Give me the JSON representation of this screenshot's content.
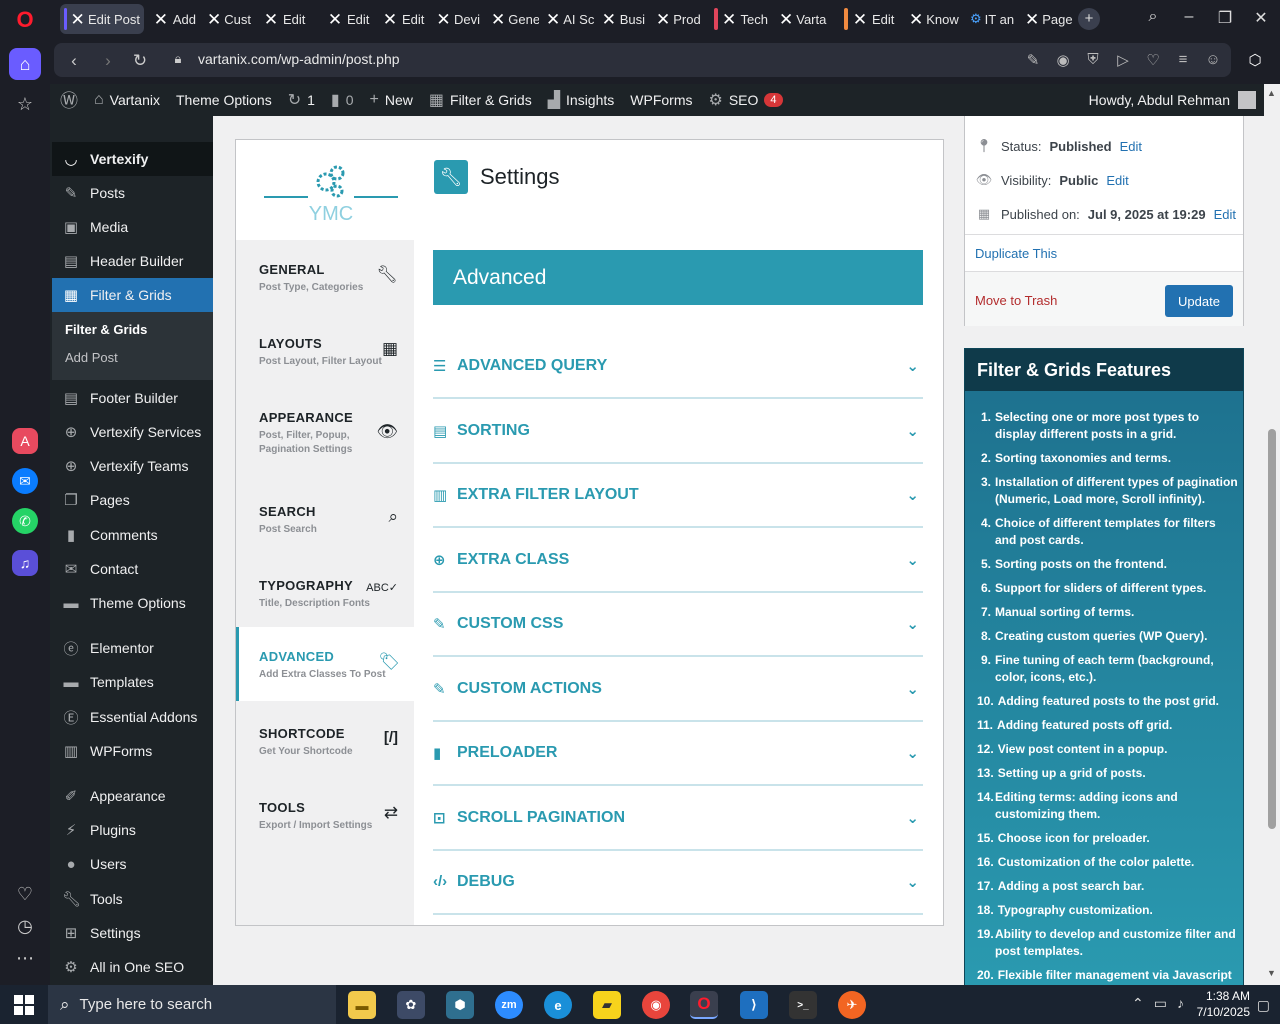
{
  "browser": {
    "tabs": [
      "Edit Post",
      "Add",
      "Cust",
      "Edit",
      "Edit",
      "Edit",
      "Devi",
      "Gene",
      "AI Sc",
      "Busi",
      "Prod",
      "Tech",
      "Varta",
      "Edit",
      "Know",
      "IT an",
      "Page"
    ],
    "url": "vartanix.com/wp-admin/post.php"
  },
  "adminbar": {
    "site": "Vartanix",
    "theme_options": "Theme Options",
    "updates": "1",
    "comments": "0",
    "new": "New",
    "filter_grids": "Filter & Grids",
    "insights": "Insights",
    "wpforms": "WPForms",
    "seo": "SEO",
    "seo_count": "4",
    "howdy": "Howdy, Abdul Rehman"
  },
  "menu": {
    "vertexify": "Vertexify",
    "posts": "Posts",
    "media": "Media",
    "header_builder": "Header Builder",
    "filter_grids": "Filter & Grids",
    "sub_filter_grids": "Filter & Grids",
    "sub_add_post": "Add Post",
    "footer_builder": "Footer Builder",
    "vertexify_services": "Vertexify Services",
    "vertexify_teams": "Vertexify Teams",
    "pages": "Pages",
    "comments": "Comments",
    "contact": "Contact",
    "theme_options": "Theme Options",
    "elementor": "Elementor",
    "templates": "Templates",
    "essential_addons": "Essential Addons",
    "wpforms": "WPForms",
    "appearance": "Appearance",
    "plugins": "Plugins",
    "users": "Users",
    "tools": "Tools",
    "settings": "Settings",
    "aioseo": "All in One SEO"
  },
  "plugin": {
    "logo_text": "YMC",
    "settings_title": "Settings",
    "tabs": [
      {
        "title": "GENERAL",
        "sub": "Post Type, Categories"
      },
      {
        "title": "LAYOUTS",
        "sub": "Post Layout, Filter Layout"
      },
      {
        "title": "APPEARANCE",
        "sub": "Post, Filter, Popup, Pagination Settings"
      },
      {
        "title": "SEARCH",
        "sub": "Post Search"
      },
      {
        "title": "TYPOGRAPHY",
        "sub": "Title, Description Fonts"
      },
      {
        "title": "ADVANCED",
        "sub": "Add Extra Classes To Post"
      },
      {
        "title": "SHORTCODE",
        "sub": "Get Your Shortcode"
      },
      {
        "title": "TOOLS",
        "sub": "Export / Import Settings"
      }
    ],
    "banner": "Advanced",
    "sections": [
      "ADVANCED QUERY",
      "SORTING",
      "EXTRA FILTER LAYOUT",
      "EXTRA CLASS",
      "CUSTOM CSS",
      "CUSTOM ACTIONS",
      "PRELOADER",
      "SCROLL PAGINATION",
      "DEBUG"
    ]
  },
  "publish": {
    "status_label": "Status:",
    "status_value": "Published",
    "visibility_label": "Visibility:",
    "visibility_value": "Public",
    "published_label": "Published on:",
    "published_value": "Jul 9, 2025 at 19:29",
    "edit": "Edit",
    "duplicate": "Duplicate This",
    "trash": "Move to Trash",
    "update": "Update"
  },
  "features": {
    "title": "Filter & Grids Features",
    "items": [
      "Selecting one or more post types to display different posts in a grid.",
      "Sorting taxonomies and terms.",
      "Installation of different types of pagination (Numeric, Load more, Scroll infinity).",
      "Choice of different templates for filters and post cards.",
      "Sorting posts on the frontend.",
      "Support for sliders of different types.",
      "Manual sorting of terms.",
      "Creating custom queries (WP Query).",
      "Fine tuning of each term (background, color, icons, etc.).",
      "Adding featured posts to the post grid.",
      "Adding featured posts off grid.",
      "View post content in a popup.",
      "Setting up a grid of posts.",
      "Editing terms: adding icons and customizing them.",
      "Choose icon for preloader.",
      "Customization of the color palette.",
      "Adding a post search bar.",
      "Typography customization.",
      "Ability to develop and customize filter and post templates.",
      "Flexible filter management via Javascript"
    ]
  },
  "taskbar": {
    "search_placeholder": "Type here to search",
    "time": "1:38 AM",
    "date": "7/10/2025"
  },
  "colors": {
    "accent": "#2a9ab0",
    "wp_blue": "#2271b1",
    "admin_dark": "#1d2327"
  }
}
